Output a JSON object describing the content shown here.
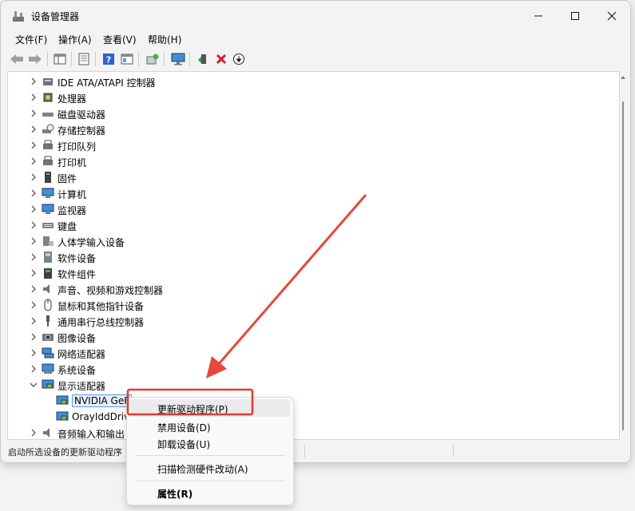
{
  "window": {
    "title": "设备管理器"
  },
  "menu": [
    "文件(F)",
    "操作(A)",
    "查看(V)",
    "帮助(H)"
  ],
  "toolbar_icons": [
    "back-arrow-icon",
    "forward-arrow-icon",
    "show-hide-tree-icon",
    "properties-icon",
    "help-icon",
    "view-icon",
    "scan-hardware-icon",
    "monitor-icon",
    "update-driver-icon",
    "uninstall-icon",
    "disable-icon"
  ],
  "tree": {
    "items": [
      {
        "label": "IDE ATA/ATAPI 控制器",
        "icon": "ide-controller-icon"
      },
      {
        "label": "处理器",
        "icon": "processor-icon"
      },
      {
        "label": "磁盘驱动器",
        "icon": "disk-drive-icon"
      },
      {
        "label": "存储控制器",
        "icon": "storage-controller-icon"
      },
      {
        "label": "打印队列",
        "icon": "print-queue-icon"
      },
      {
        "label": "打印机",
        "icon": "printer-icon"
      },
      {
        "label": "固件",
        "icon": "firmware-icon"
      },
      {
        "label": "计算机",
        "icon": "computer-icon"
      },
      {
        "label": "监视器",
        "icon": "monitor-icon"
      },
      {
        "label": "键盘",
        "icon": "keyboard-icon"
      },
      {
        "label": "人体学输入设备",
        "icon": "hid-icon"
      },
      {
        "label": "软件设备",
        "icon": "software-device-icon"
      },
      {
        "label": "软件组件",
        "icon": "software-component-icon"
      },
      {
        "label": "声音、视频和游戏控制器",
        "icon": "sound-icon"
      },
      {
        "label": "鼠标和其他指针设备",
        "icon": "mouse-icon"
      },
      {
        "label": "通用串行总线控制器",
        "icon": "usb-icon"
      },
      {
        "label": "图像设备",
        "icon": "camera-icon"
      },
      {
        "label": "网络适配器",
        "icon": "network-adapter-icon"
      },
      {
        "label": "系统设备",
        "icon": "system-device-icon"
      },
      {
        "label": "显示适配器",
        "icon": "display-adapter-icon"
      }
    ],
    "display_children": [
      {
        "label": "NVIDIA GeF",
        "icon": "display-adapter-icon"
      },
      {
        "label": "OrayIddDriv",
        "icon": "display-adapter-icon"
      }
    ],
    "audio_item": {
      "label": "音频输入和输出",
      "icon": "audio-icon"
    }
  },
  "context_menu": {
    "update": "更新驱动程序(P)",
    "disable": "禁用设备(D)",
    "uninstall": "卸载设备(U)",
    "scan": "扫描检测硬件改动(A)",
    "properties": "属性(R)"
  },
  "status": {
    "text": "启动所选设备的更新驱动程序"
  },
  "colors": {
    "accent": "#0067c0",
    "highlight_box": "#e53935",
    "arrow": "#e8473c"
  }
}
